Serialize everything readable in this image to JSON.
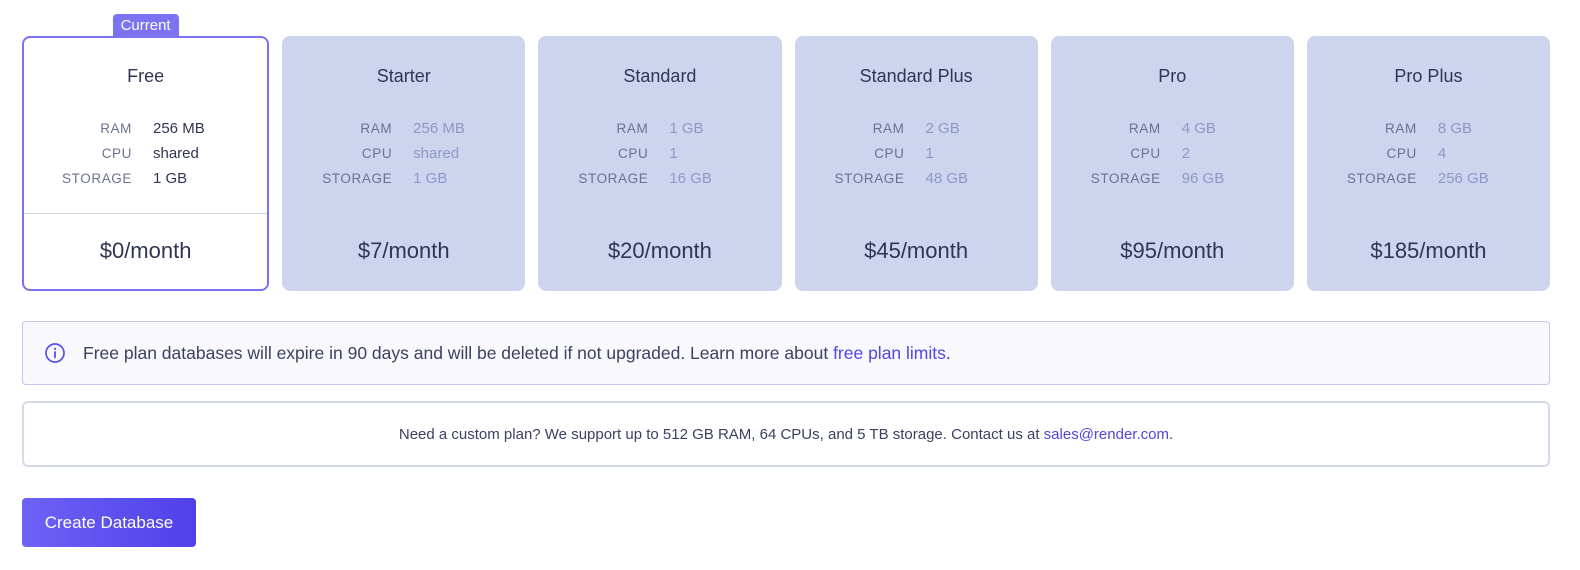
{
  "current_badge": "Current",
  "plans": [
    {
      "name": "Free",
      "ram": "256 MB",
      "cpu": "shared",
      "storage": "1 GB",
      "price": "$0/month",
      "current": true
    },
    {
      "name": "Starter",
      "ram": "256 MB",
      "cpu": "shared",
      "storage": "1 GB",
      "price": "$7/month"
    },
    {
      "name": "Standard",
      "ram": "1 GB",
      "cpu": "1",
      "storage": "16 GB",
      "price": "$20/month"
    },
    {
      "name": "Standard Plus",
      "ram": "2 GB",
      "cpu": "1",
      "storage": "48 GB",
      "price": "$45/month"
    },
    {
      "name": "Pro",
      "ram": "4 GB",
      "cpu": "2",
      "storage": "96 GB",
      "price": "$95/month"
    },
    {
      "name": "Pro Plus",
      "ram": "8 GB",
      "cpu": "4",
      "storage": "256 GB",
      "price": "$185/month"
    }
  ],
  "spec_labels": {
    "ram": "RAM",
    "cpu": "CPU",
    "storage": "STORAGE"
  },
  "notice": {
    "text": "Free plan databases will expire in 90 days and will be deleted if not upgraded. Learn more about ",
    "link_text": "free plan limits",
    "suffix": ".",
    "icon": "info-icon"
  },
  "custom_plan": {
    "text": "Need a custom plan? We support up to 512 GB RAM, 64 CPUs, and 5 TB storage. Contact us at ",
    "email": "sales@render.com",
    "suffix": "."
  },
  "create_button": "Create Database",
  "colors": {
    "accent": "#5046e5",
    "plan_card_bg": "#cdd5ee",
    "current_border": "#7a72f2"
  }
}
